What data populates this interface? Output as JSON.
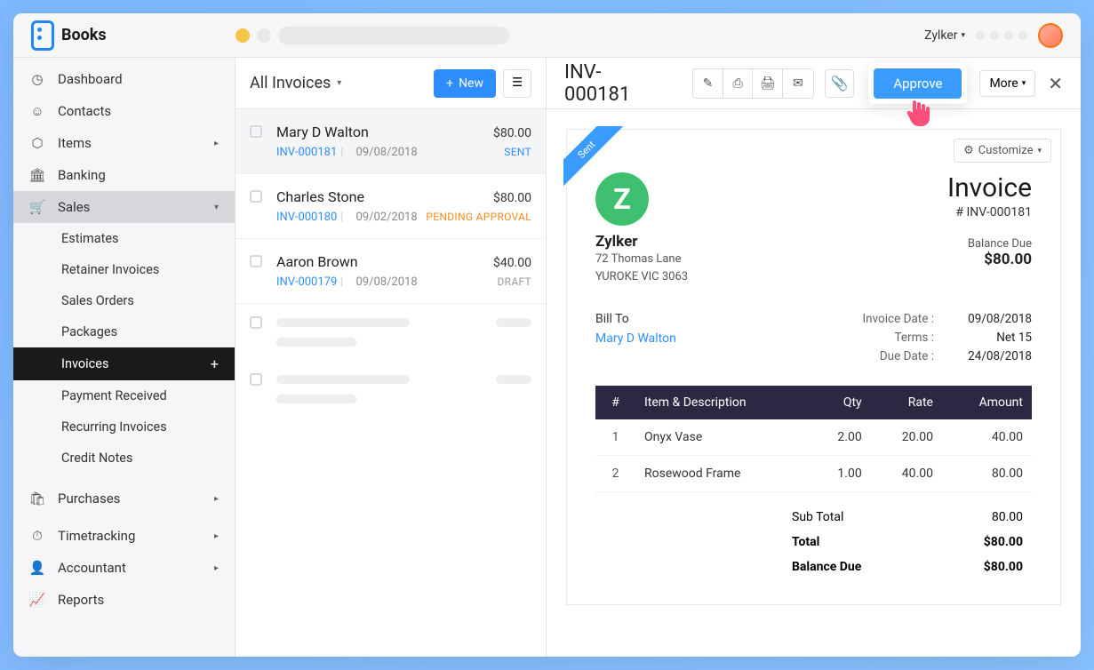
{
  "brand": "Books",
  "org": "Zylker",
  "sidebar": {
    "dashboard": "Dashboard",
    "contacts": "Contacts",
    "items": "Items",
    "banking": "Banking",
    "sales": "Sales",
    "estimates": "Estimates",
    "retainer": "Retainer Invoices",
    "salesorders": "Sales Orders",
    "packages": "Packages",
    "invoices": "Invoices",
    "payment": "Payment Received",
    "recurring": "Recurring Invoices",
    "creditnotes": "Credit Notes",
    "purchases": "Purchases",
    "timetracking": "Timetracking",
    "accountant": "Accountant",
    "reports": "Reports"
  },
  "list": {
    "title": "All Invoices",
    "new_btn": "New",
    "rows": [
      {
        "customer": "Mary D Walton",
        "amount": "$80.00",
        "inv": "INV-000181",
        "date": "09/08/2018",
        "status": "SENT",
        "status_class": "sent"
      },
      {
        "customer": "Charles Stone",
        "amount": "$80.00",
        "inv": "INV-000180",
        "date": "09/02/2018",
        "status": "PENDING APPROVAL",
        "status_class": "pending"
      },
      {
        "customer": "Aaron Brown",
        "amount": "$40.00",
        "inv": "INV-000179",
        "date": "09/08/2018",
        "status": "DRAFT",
        "status_class": "draft"
      }
    ]
  },
  "detail": {
    "title": "INV-000181",
    "approve": "Approve",
    "more": "More",
    "customize": "Customize",
    "ribbon": "Sent",
    "company": {
      "logo_letter": "Z",
      "name": "Zylker",
      "line1": "72 Thomas Lane",
      "line2": "YUROKE VIC 3063"
    },
    "doc_type": "Invoice",
    "doc_num": "# INV-000181",
    "balance_label": "Balance Due",
    "balance_amount": "$80.00",
    "bill_to_label": "Bill To",
    "bill_to_name": "Mary D Walton",
    "meta": {
      "invoice_date_label": "Invoice Date :",
      "invoice_date": "09/08/2018",
      "terms_label": "Terms :",
      "terms": "Net 15",
      "due_label": "Due Date :",
      "due": "24/08/2018"
    },
    "headers": {
      "num": "#",
      "desc": "Item & Description",
      "qty": "Qty",
      "rate": "Rate",
      "amount": "Amount"
    },
    "items": [
      {
        "n": "1",
        "desc": "Onyx Vase",
        "qty": "2.00",
        "rate": "20.00",
        "amount": "40.00"
      },
      {
        "n": "2",
        "desc": "Rosewood Frame",
        "qty": "1.00",
        "rate": "40.00",
        "amount": "80.00"
      }
    ],
    "totals": {
      "sub_label": "Sub Total",
      "sub": "80.00",
      "total_label": "Total",
      "total": "$80.00",
      "bal_label": "Balance Due",
      "bal": "$80.00"
    }
  }
}
